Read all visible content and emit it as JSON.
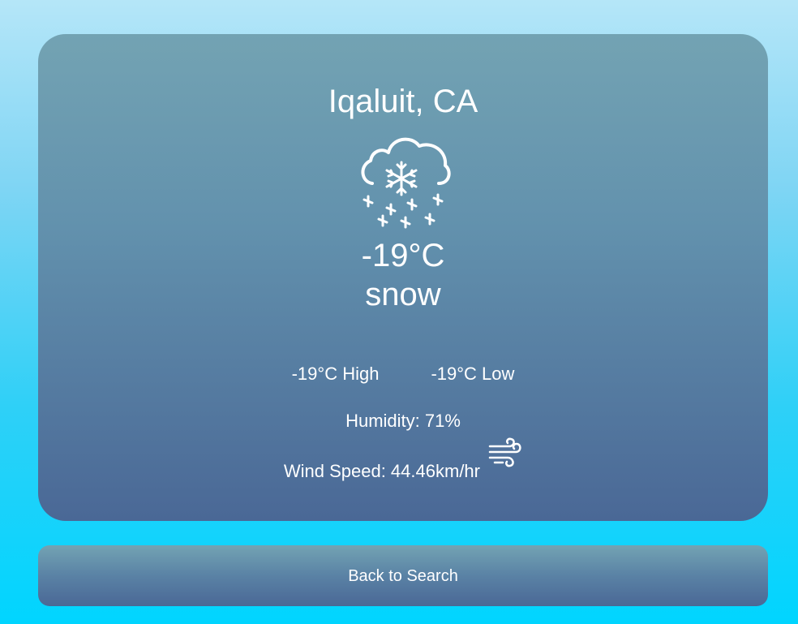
{
  "weather": {
    "city": "Iqaluit, CA",
    "condition_icon": "snow-cloud-icon",
    "temperature": "-19°C",
    "description": "snow",
    "high": "-19°C High",
    "low": "-19°C Low",
    "humidity": "Humidity: 71%",
    "wind_speed": "Wind Speed: 44.46km/hr",
    "wind_icon": "wind-icon"
  },
  "actions": {
    "back_label": "Back to Search"
  },
  "colors": {
    "background_top": "#b5e6f8",
    "background_bottom": "#00d5ff",
    "card_top": "#73a3b3",
    "card_bottom": "#4a6896",
    "text": "#ffffff"
  }
}
